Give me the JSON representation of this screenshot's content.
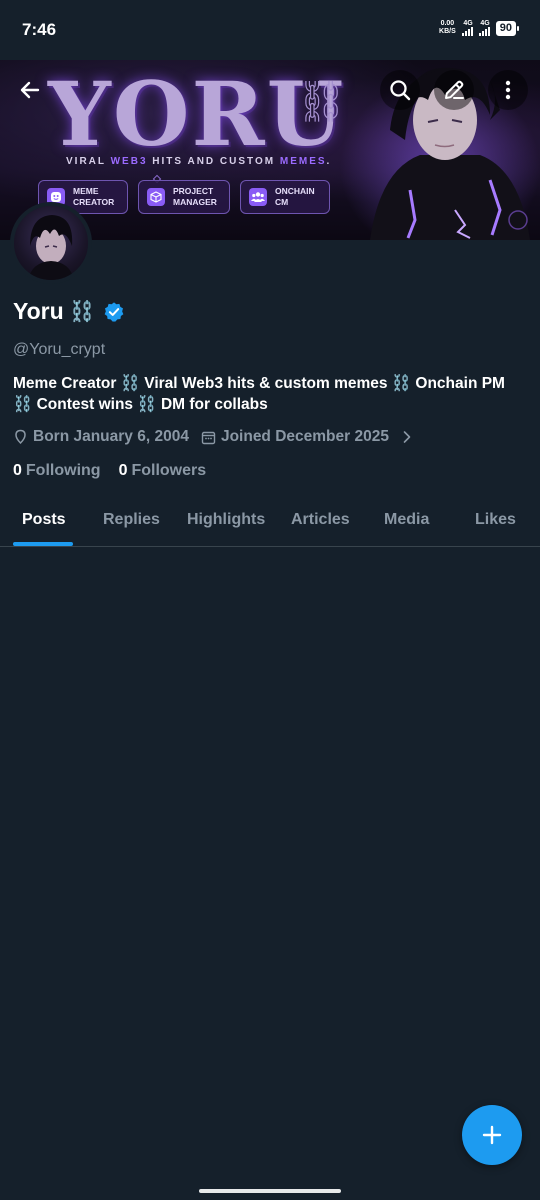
{
  "status_bar": {
    "time": "7:46",
    "net_speed_value": "0.00",
    "net_speed_unit": "KB/S",
    "signal1_label": "4G",
    "signal2_label": "4G",
    "battery": "90"
  },
  "banner": {
    "title": "YORU",
    "subtitle_parts": [
      "VIRAL ",
      "WEB3",
      " HITS AND CUSTOM ",
      "MEMES",
      "."
    ],
    "badges": [
      {
        "line1": "MEME",
        "line2": "CREATOR",
        "icon": "smiley-icon"
      },
      {
        "line1": "PROJECT",
        "line2": "MANAGER",
        "icon": "cube-icon"
      },
      {
        "line1": "ONCHAIN",
        "line2": "CM",
        "icon": "group-icon"
      }
    ]
  },
  "header": {
    "back_icon": "arrow-left-icon",
    "search_icon": "search-icon",
    "edit_icon": "pencil-icon",
    "more_icon": "more-vertical-icon"
  },
  "profile": {
    "display_name": "Yoru",
    "name_emoji": "⛓️",
    "verified": true,
    "handle": "@Yoru_crypt",
    "bio": "Meme Creator  ⛓️ Viral Web3 hits & custom memes ⛓️ Onchain PM ⛓️ Contest wins ⛓️ DM for collabs",
    "born": "Born January 6, 2004",
    "joined": "Joined December 2025",
    "following_count": "0",
    "following_label": "Following",
    "followers_count": "0",
    "followers_label": "Followers"
  },
  "tabs": [
    {
      "label": "Posts",
      "active": true
    },
    {
      "label": "Replies",
      "active": false
    },
    {
      "label": "Highlights",
      "active": false
    },
    {
      "label": "Articles",
      "active": false
    },
    {
      "label": "Media",
      "active": false
    },
    {
      "label": "Likes",
      "active": false
    }
  ],
  "fab": {
    "icon": "plus-icon"
  },
  "colors": {
    "background": "#15202b",
    "accent": "#1d9bf0",
    "secondary_text": "#8b98a5",
    "divider": "#38444d",
    "banner_accent": "#8a5cf5"
  }
}
